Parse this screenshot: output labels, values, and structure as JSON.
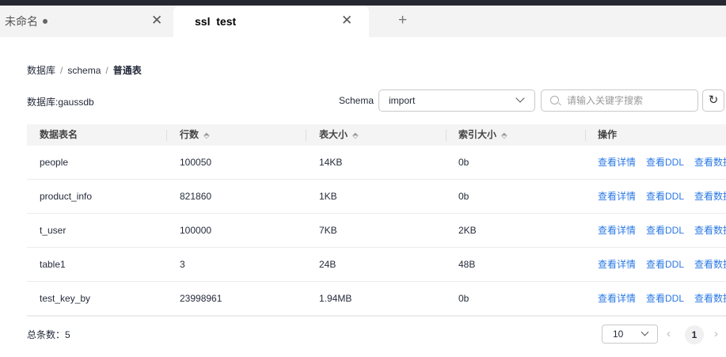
{
  "tabs": [
    {
      "label": "未命名",
      "modified": true
    },
    {
      "label": "ssl  test",
      "active": true
    }
  ],
  "breadcrumb": [
    "数据库",
    "schema",
    "普通表"
  ],
  "db_label": "数据库:gaussdb",
  "schema": {
    "label": "Schema",
    "value": "import"
  },
  "search": {
    "placeholder": "请输入关键字搜索"
  },
  "columns": [
    "数据表名",
    "行数",
    "表大小",
    "索引大小",
    "操作"
  ],
  "rows": [
    {
      "name": "people",
      "rows": "100050",
      "size": "14KB",
      "index": "0b"
    },
    {
      "name": "product_info",
      "rows": "821860",
      "size": "1KB",
      "index": "0b"
    },
    {
      "name": "t_user",
      "rows": "100000",
      "size": "7KB",
      "index": "2KB"
    },
    {
      "name": "table1",
      "rows": "3",
      "size": "24B",
      "index": "48B"
    },
    {
      "name": "test_key_by",
      "rows": "23998961",
      "size": "1.94MB",
      "index": "0b"
    }
  ],
  "actions": [
    "查看详情",
    "查看DDL",
    "查看数据"
  ],
  "footer": {
    "total": "总条数：5",
    "page_size": "10",
    "page": "1"
  }
}
